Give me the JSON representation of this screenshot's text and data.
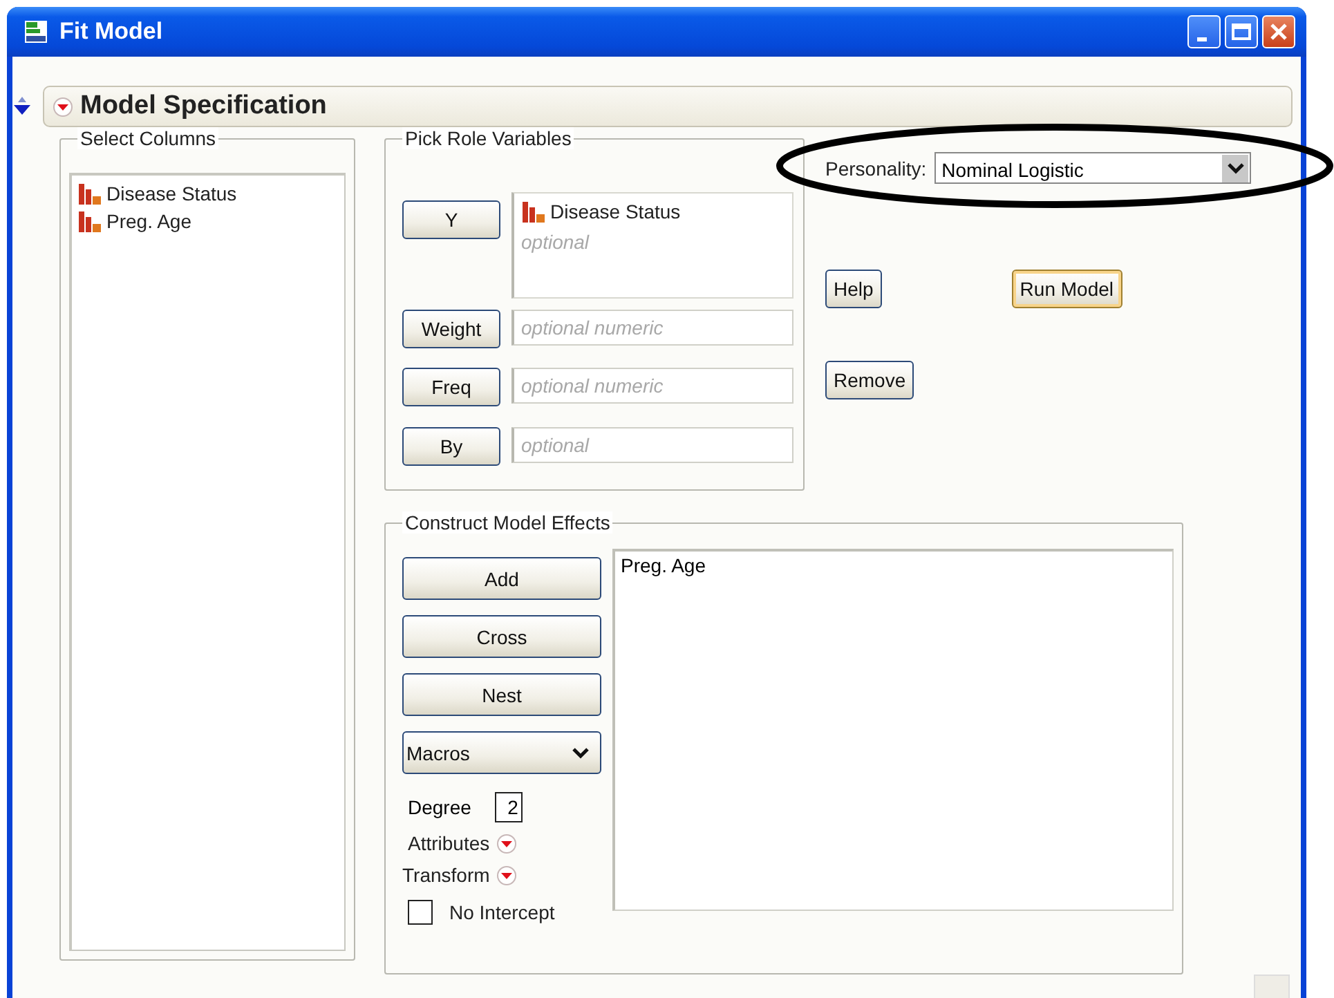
{
  "window": {
    "title": "Fit Model"
  },
  "outline": {
    "title": "Model Specification",
    "expanded": true
  },
  "select_columns": {
    "title": "Select Columns",
    "items": [
      {
        "label": "Disease Status"
      },
      {
        "label": "Preg. Age"
      }
    ]
  },
  "pick_role": {
    "title": "Pick Role Variables",
    "roles": [
      {
        "kind": "list",
        "button": "Y",
        "values": [
          "Disease Status"
        ],
        "placeholder": "optional"
      },
      {
        "kind": "field",
        "button": "Weight",
        "placeholder": "optional numeric"
      },
      {
        "kind": "field",
        "button": "Freq",
        "placeholder": "optional numeric"
      },
      {
        "kind": "field",
        "button": "By",
        "placeholder": "optional"
      }
    ]
  },
  "personality": {
    "label": "Personality:",
    "value": "Nominal Logistic",
    "highlighted": true
  },
  "actions": [
    {
      "label": "Help",
      "default": false
    },
    {
      "label": "Run Model",
      "default": true
    },
    {
      "label": "Remove",
      "default": false
    }
  ],
  "effects": {
    "title": "Construct Model Effects",
    "buttons": [
      "Add",
      "Cross",
      "Nest"
    ],
    "macros": "Macros",
    "degree_label": "Degree",
    "degree": "2",
    "menus": [
      "Attributes",
      "Transform"
    ],
    "no_intercept": {
      "label": "No Intercept",
      "checked": false
    },
    "items": [
      "Preg. Age"
    ]
  }
}
